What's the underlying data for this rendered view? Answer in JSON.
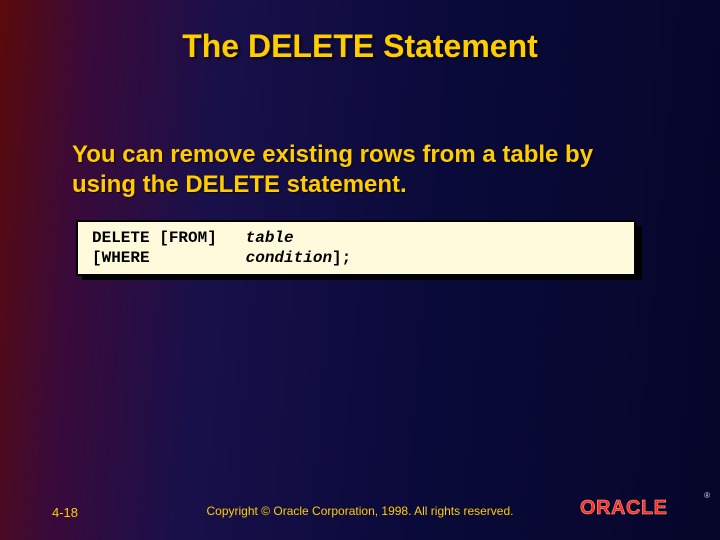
{
  "title": "The DELETE Statement",
  "description": "You can remove existing rows from a table by using the DELETE statement.",
  "code": {
    "l1a": "DELETE [FROM]   ",
    "l1b": "table",
    "l2a": "[WHERE          ",
    "l2b": "condition",
    "l2c": "];"
  },
  "footer": {
    "page": "4-18",
    "copyright": "Copyright © Oracle Corporation, 1998. All rights reserved.",
    "logo": "ORACLE",
    "reg": "®"
  }
}
